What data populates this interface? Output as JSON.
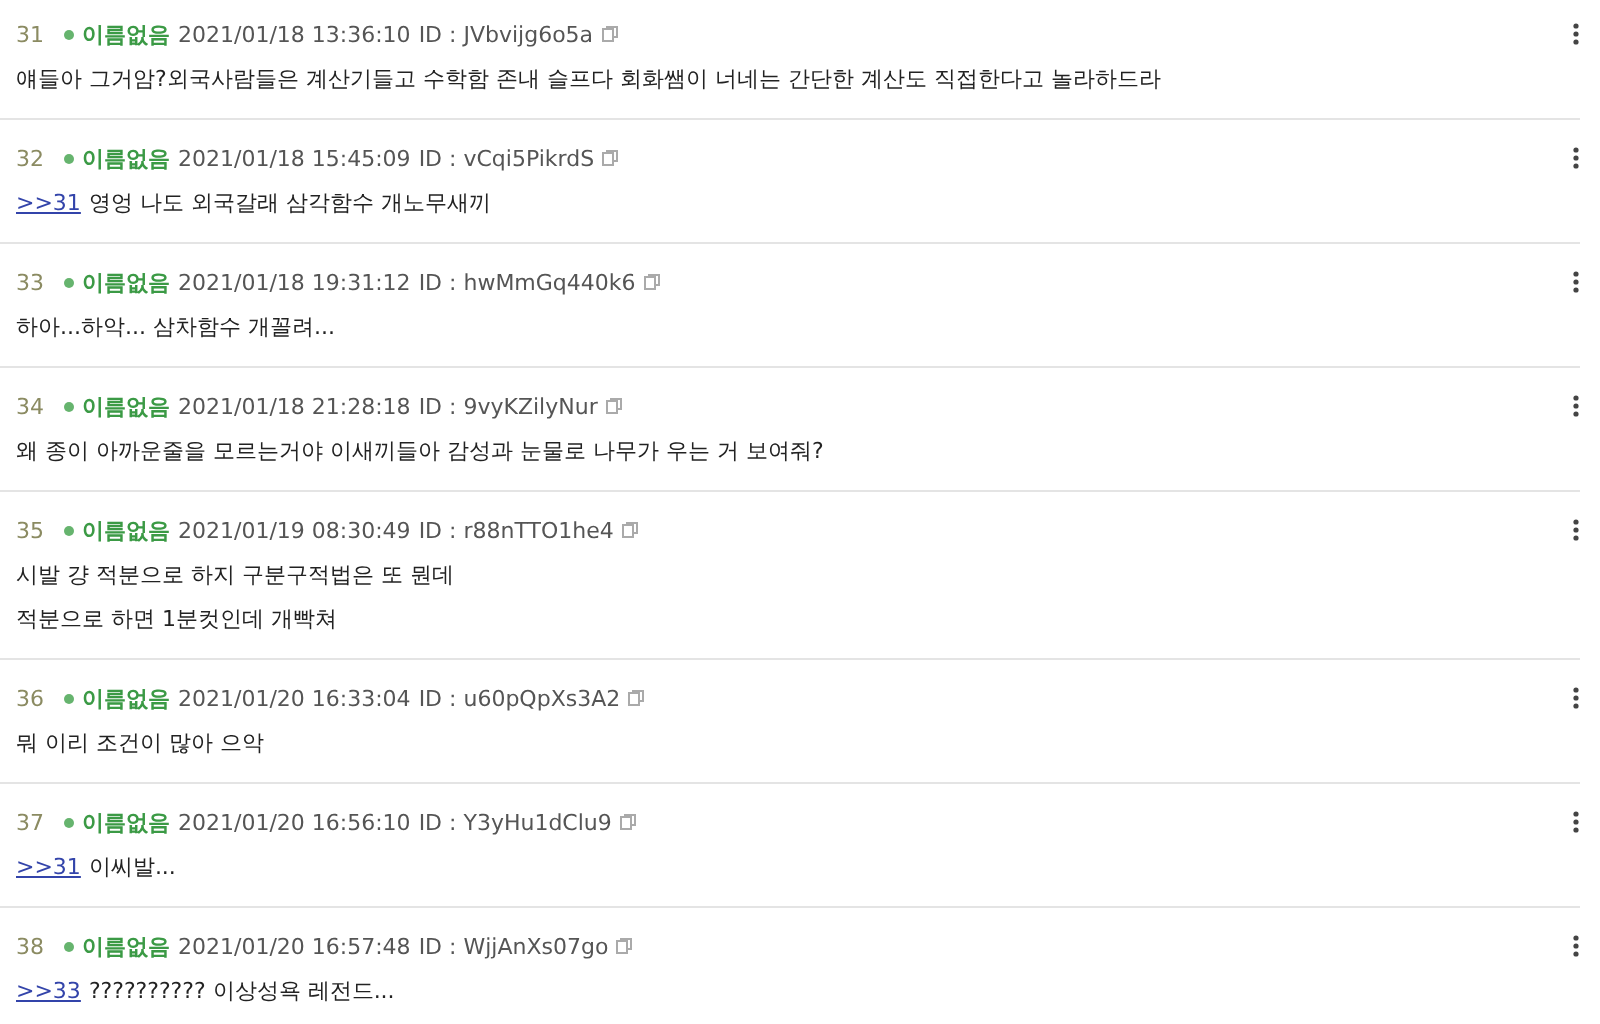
{
  "posts": [
    {
      "number": "31",
      "name": "이름없음",
      "date": "2021/01/18 13:36:10",
      "id": "ID : JVbvijg6o5a",
      "lines": [
        {
          "text": "얘들아 그거암?외국사람들은 계산기들고 수학함 존내 슬프다 회화쌤이 너네는 간단한 계산도 직접한다고 놀라하드라"
        }
      ]
    },
    {
      "number": "32",
      "name": "이름없음",
      "date": "2021/01/18 15:45:09",
      "id": "ID : vCqi5PikrdS",
      "lines": [
        {
          "reply": ">>31",
          "text": "영엉 나도 외국갈래 삼각함수 개노무새끼"
        }
      ]
    },
    {
      "number": "33",
      "name": "이름없음",
      "date": "2021/01/18 19:31:12",
      "id": "ID : hwMmGq440k6",
      "lines": [
        {
          "text": "하아...하악... 삼차함수 개꼴려..."
        }
      ]
    },
    {
      "number": "34",
      "name": "이름없음",
      "date": "2021/01/18 21:28:18",
      "id": "ID : 9vyKZilyNur",
      "lines": [
        {
          "text": "왜 종이 아까운줄을 모르는거야 이새끼들아 감성과 눈물로 나무가 우는 거 보여줘?"
        }
      ]
    },
    {
      "number": "35",
      "name": "이름없음",
      "date": "2021/01/19 08:30:49",
      "id": "ID : r88nTTO1he4",
      "lines": [
        {
          "text": "시발 걍 적분으로 하지 구분구적법은 또 뭔데"
        },
        {
          "text": "적분으로 하면 1분컷인데 개빡쳐"
        }
      ]
    },
    {
      "number": "36",
      "name": "이름없음",
      "date": "2021/01/20 16:33:04",
      "id": "ID : u60pQpXs3A2",
      "lines": [
        {
          "text": "뭐 이리 조건이 많아 으악"
        }
      ]
    },
    {
      "number": "37",
      "name": "이름없음",
      "date": "2021/01/20 16:56:10",
      "id": "ID : Y3yHu1dClu9",
      "lines": [
        {
          "reply": ">>31",
          "text": "이씨발..."
        }
      ]
    },
    {
      "number": "38",
      "name": "이름없음",
      "date": "2021/01/20 16:57:48",
      "id": "ID : WjjAnXs07go",
      "lines": [
        {
          "reply": ">>33",
          "text": "?????????? 이상성욕 레전드..."
        }
      ]
    }
  ]
}
